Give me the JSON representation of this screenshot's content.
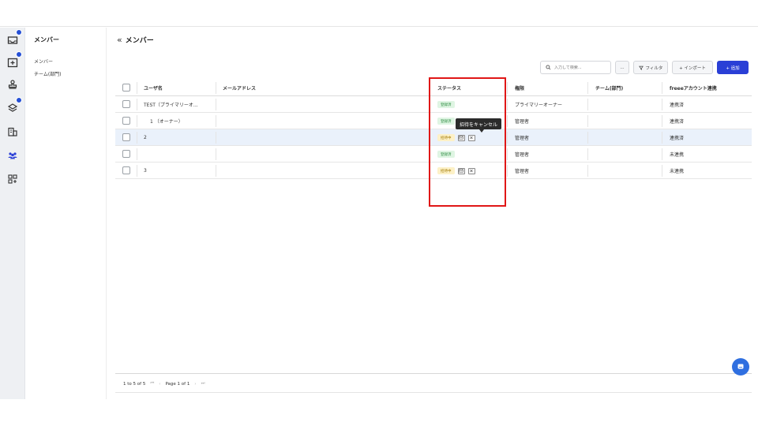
{
  "rail": {
    "items": [
      {
        "icon": "inbox-icon",
        "badge": true
      },
      {
        "icon": "calendar-add-icon",
        "badge": true
      },
      {
        "icon": "stamp-icon",
        "badge": false
      },
      {
        "icon": "layers-icon",
        "badge": true
      },
      {
        "icon": "building-icon",
        "badge": false
      },
      {
        "icon": "users-icon",
        "badge": false,
        "active": true
      },
      {
        "icon": "apps-icon",
        "badge": false
      }
    ]
  },
  "subnav": {
    "title": "メンバー",
    "items": [
      "メンバー",
      "チーム(部門)"
    ]
  },
  "main": {
    "title": "メンバー",
    "search_placeholder": "入力して検索...",
    "more_label": "...",
    "filter_label": "フィルタ",
    "import_label": "+ インポート",
    "add_label": "+ 追加"
  },
  "table": {
    "columns": [
      "ユーザ名",
      "メールアドレス",
      "ステータス",
      "権限",
      "チーム(部門)",
      "freeeアカウント連携"
    ],
    "rows": [
      {
        "name": "TEST（プライマリーオ...",
        "email": "",
        "status": "登録済",
        "status_type": "registered",
        "role": "プライマリーオーナー",
        "team": "",
        "freee": "連携済",
        "selected": false
      },
      {
        "name": "1 （オーナー）",
        "email": "",
        "status": "登録済",
        "status_type": "registered",
        "role": "管理者",
        "team": "",
        "freee": "連携済",
        "selected": false
      },
      {
        "name": "2",
        "email": "",
        "status": "招待中",
        "status_type": "inviting",
        "role": "管理者",
        "team": "",
        "freee": "連携済",
        "selected": true
      },
      {
        "name": "",
        "email": "",
        "status": "登録済",
        "status_type": "registered",
        "role": "管理者",
        "team": "",
        "freee": "未連携",
        "selected": false
      },
      {
        "name": "3",
        "email": "",
        "status": "招待中",
        "status_type": "inviting",
        "role": "管理者",
        "team": "",
        "freee": "未連携",
        "selected": false
      }
    ]
  },
  "tooltip": {
    "text": "招待をキャンセル"
  },
  "pagination": {
    "range": "1 to 5 of 5",
    "page_label": "Page 1 of 1",
    "first": "⏮",
    "prev": "‹",
    "next": "›",
    "last": "⏭"
  },
  "colors": {
    "accent": "#2a3fd6",
    "highlight": "#e01717",
    "registered": "#dff5e3",
    "inviting": "#fdf1c7"
  }
}
